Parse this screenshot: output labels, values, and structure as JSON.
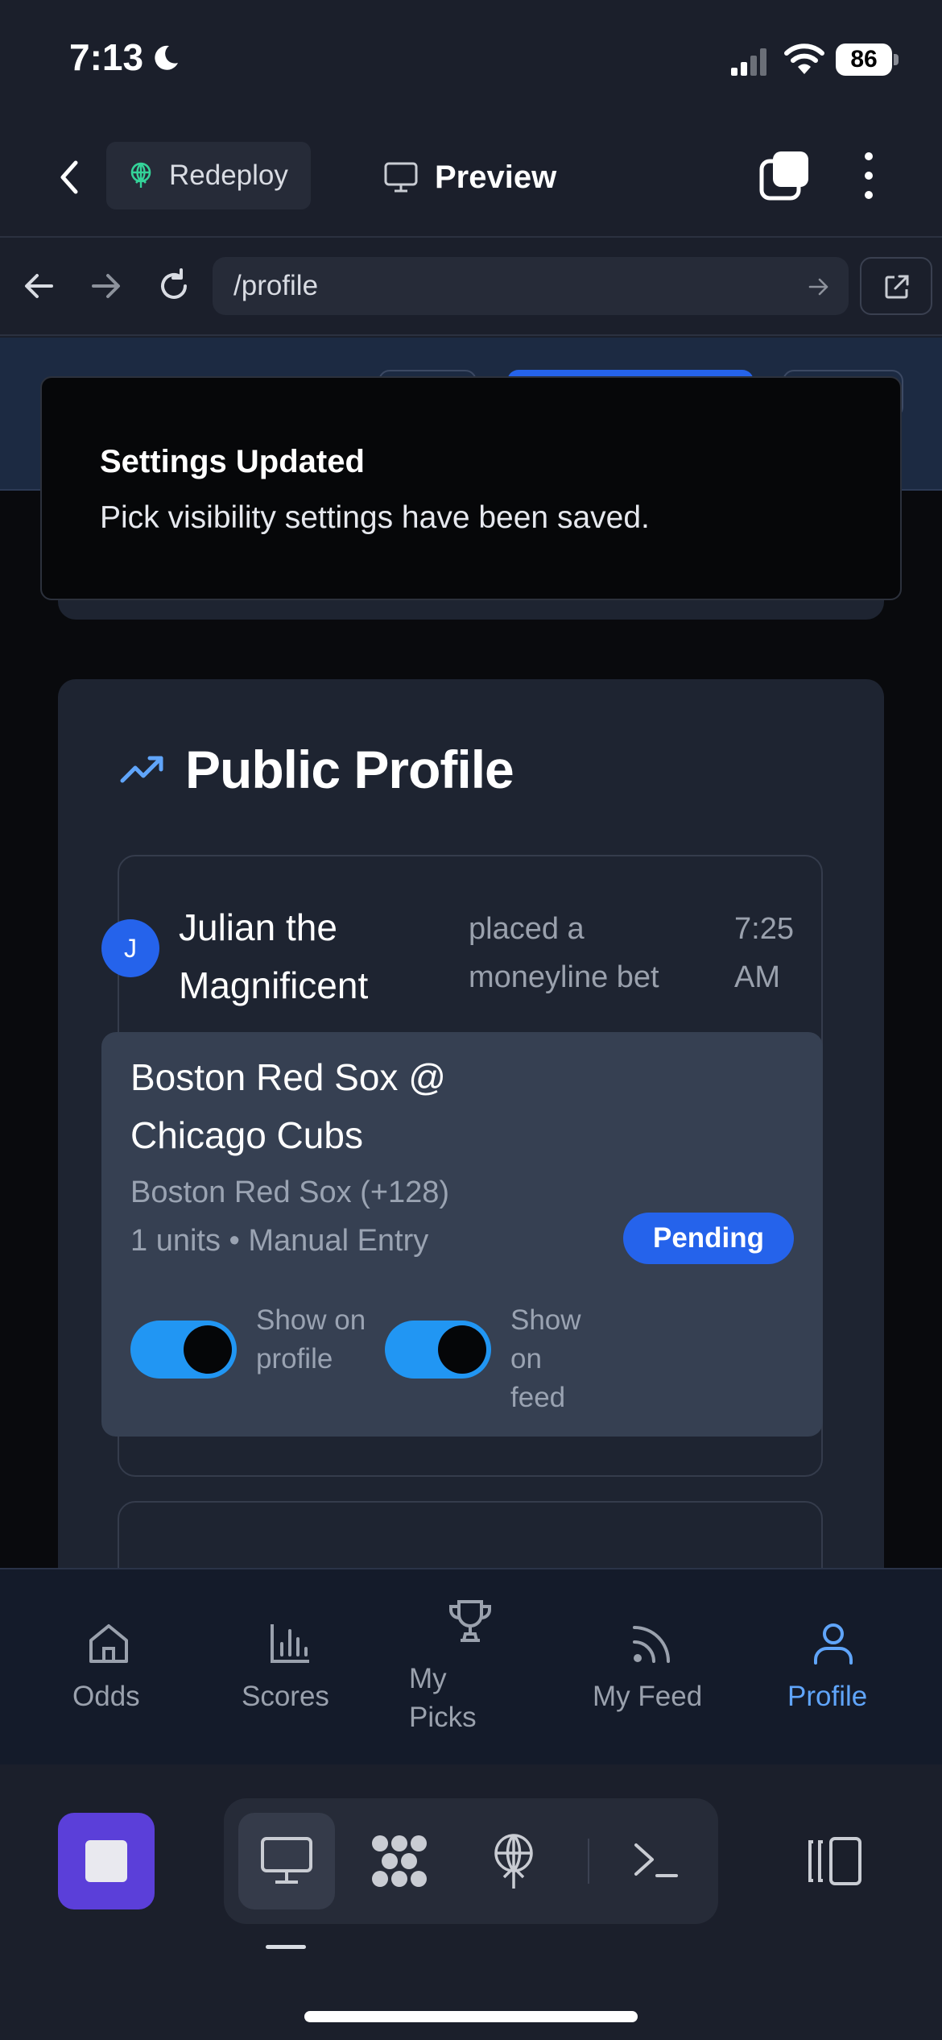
{
  "status_bar": {
    "time": "7:13",
    "battery": "86"
  },
  "app_header": {
    "redeploy_label": "Redeploy",
    "preview_label": "Preview"
  },
  "browser": {
    "url": "/profile"
  },
  "toast": {
    "title": "Settings Updated",
    "description": "Pick visibility settings have been saved."
  },
  "profile": {
    "section_title": "Public Profile",
    "pick": {
      "avatar_initial": "J",
      "user_name": "Julian the Magnificent",
      "action": "placed a moneyline bet",
      "time": "7:25 AM",
      "game": "Boston Red Sox @ Chicago Cubs",
      "selection": "Boston Red Sox (+128)",
      "meta": "1 units • Manual Entry",
      "status": "Pending",
      "toggle_profile_label": "Show on profile",
      "toggle_feed_label": "Show on feed",
      "show_on_profile": true,
      "show_on_feed": true
    }
  },
  "site_nav": {
    "items": [
      {
        "label": "Odds",
        "icon": "home-icon"
      },
      {
        "label": "Scores",
        "icon": "bar-chart-icon"
      },
      {
        "label": "My Picks",
        "icon": "trophy-icon"
      },
      {
        "label": "My Feed",
        "icon": "rss-icon"
      },
      {
        "label": "Profile",
        "icon": "user-icon",
        "active": true
      }
    ],
    "active_color": "#60a5fa"
  },
  "colors": {
    "accent": "#2563eb",
    "toggle_on": "#2196f3",
    "stop_button": "#5b3fd9"
  }
}
